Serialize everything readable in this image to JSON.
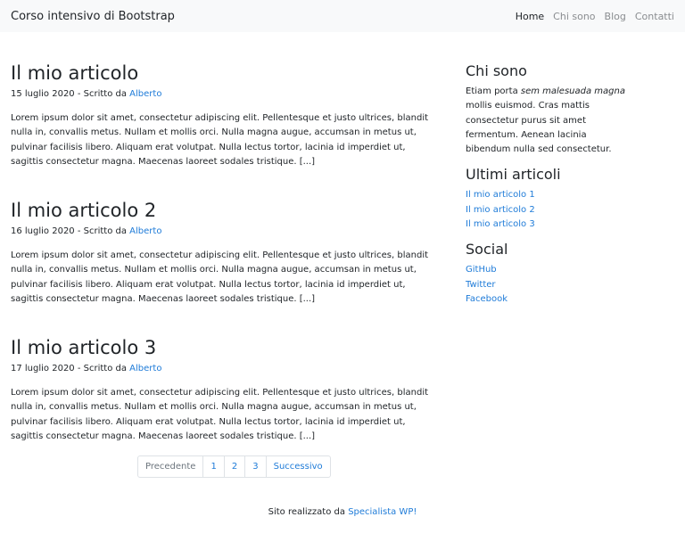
{
  "navbar": {
    "brand": "Corso intensivo di Bootstrap",
    "links": [
      "Home",
      "Chi sono",
      "Blog",
      "Contatti"
    ]
  },
  "posts": [
    {
      "title": "Il mio articolo",
      "date": "15 luglio 2020",
      "by": " - Scritto da ",
      "author": "Alberto",
      "body": "Lorem ipsum dolor sit amet, consectetur adipiscing elit. Pellentesque et justo ultrices, blandit nulla in, convallis metus. Nullam et mollis orci. Nulla magna augue, accumsan in metus ut, pulvinar facilisis libero. Aliquam erat volutpat. Nulla lectus tortor, lacinia id imperdiet ut, sagittis consectetur magna. Maecenas laoreet sodales tristique. [...]"
    },
    {
      "title": "Il mio articolo 2",
      "date": "16 luglio 2020",
      "by": " - Scritto da ",
      "author": "Alberto",
      "body": "Lorem ipsum dolor sit amet, consectetur adipiscing elit. Pellentesque et justo ultrices, blandit nulla in, convallis metus. Nullam et mollis orci. Nulla magna augue, accumsan in metus ut, pulvinar facilisis libero. Aliquam erat volutpat. Nulla lectus tortor, lacinia id imperdiet ut, sagittis consectetur magna. Maecenas laoreet sodales tristique. [...]"
    },
    {
      "title": "Il mio articolo 3",
      "date": "17 luglio 2020",
      "by": " - Scritto da ",
      "author": "Alberto",
      "body": "Lorem ipsum dolor sit amet, consectetur adipiscing elit. Pellentesque et justo ultrices, blandit nulla in, convallis metus. Nullam et mollis orci. Nulla magna augue, accumsan in metus ut, pulvinar facilisis libero. Aliquam erat volutpat. Nulla lectus tortor, lacinia id imperdiet ut, sagittis consectetur magna. Maecenas laoreet sodales tristique. [...]"
    }
  ],
  "pagination": [
    "Precedente",
    "1",
    "2",
    "3",
    "Successivo"
  ],
  "sidebar": {
    "about_title": "Chi sono",
    "about_text_before": "Etiam porta ",
    "about_text_em": "sem malesuada magna",
    "about_text_after": " mollis euismod. Cras mattis consectetur purus sit amet fermentum. Aenean lacinia bibendum nulla sed consectetur.",
    "recent_title": "Ultimi articoli",
    "recent": [
      "Il mio articolo 1",
      "Il mio articolo 2",
      "Il mio articolo 3"
    ],
    "social_title": "Social",
    "social": [
      "GitHub",
      "Twitter",
      "Facebook"
    ]
  },
  "footer": {
    "text": "Sito realizzato da ",
    "link": "Specialista WP!"
  },
  "colors": {
    "link": "#1e7bd8",
    "navbar_bg": "#f8f9fa",
    "text": "#212529"
  }
}
